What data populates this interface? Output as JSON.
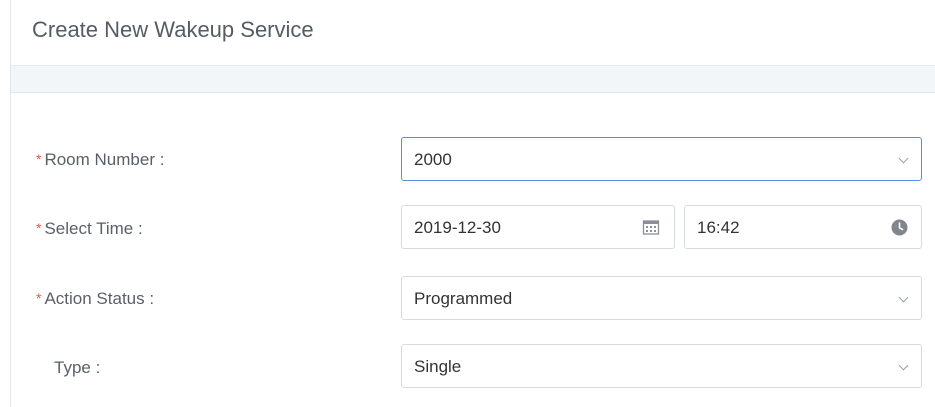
{
  "dialog": {
    "title": "Create New Wakeup Service"
  },
  "form": {
    "room_number": {
      "label": "Room Number",
      "sep": ":",
      "required_mark": "*",
      "value": "2000"
    },
    "select_time": {
      "label": "Select Time",
      "sep": ":",
      "required_mark": "*",
      "date": "2019-12-30",
      "time": "16:42"
    },
    "action_status": {
      "label": "Action Status",
      "sep": ":",
      "required_mark": "*",
      "value": "Programmed"
    },
    "type": {
      "label": "Type",
      "sep": ":",
      "value": "Single"
    }
  },
  "icons": {
    "date": "calendar-icon",
    "time": "clock-icon",
    "dropdown": "chevron-down-icon"
  },
  "colors": {
    "required": "#e8584a",
    "focus_border": "#5b8ed6",
    "band": "#f3f6f9"
  }
}
